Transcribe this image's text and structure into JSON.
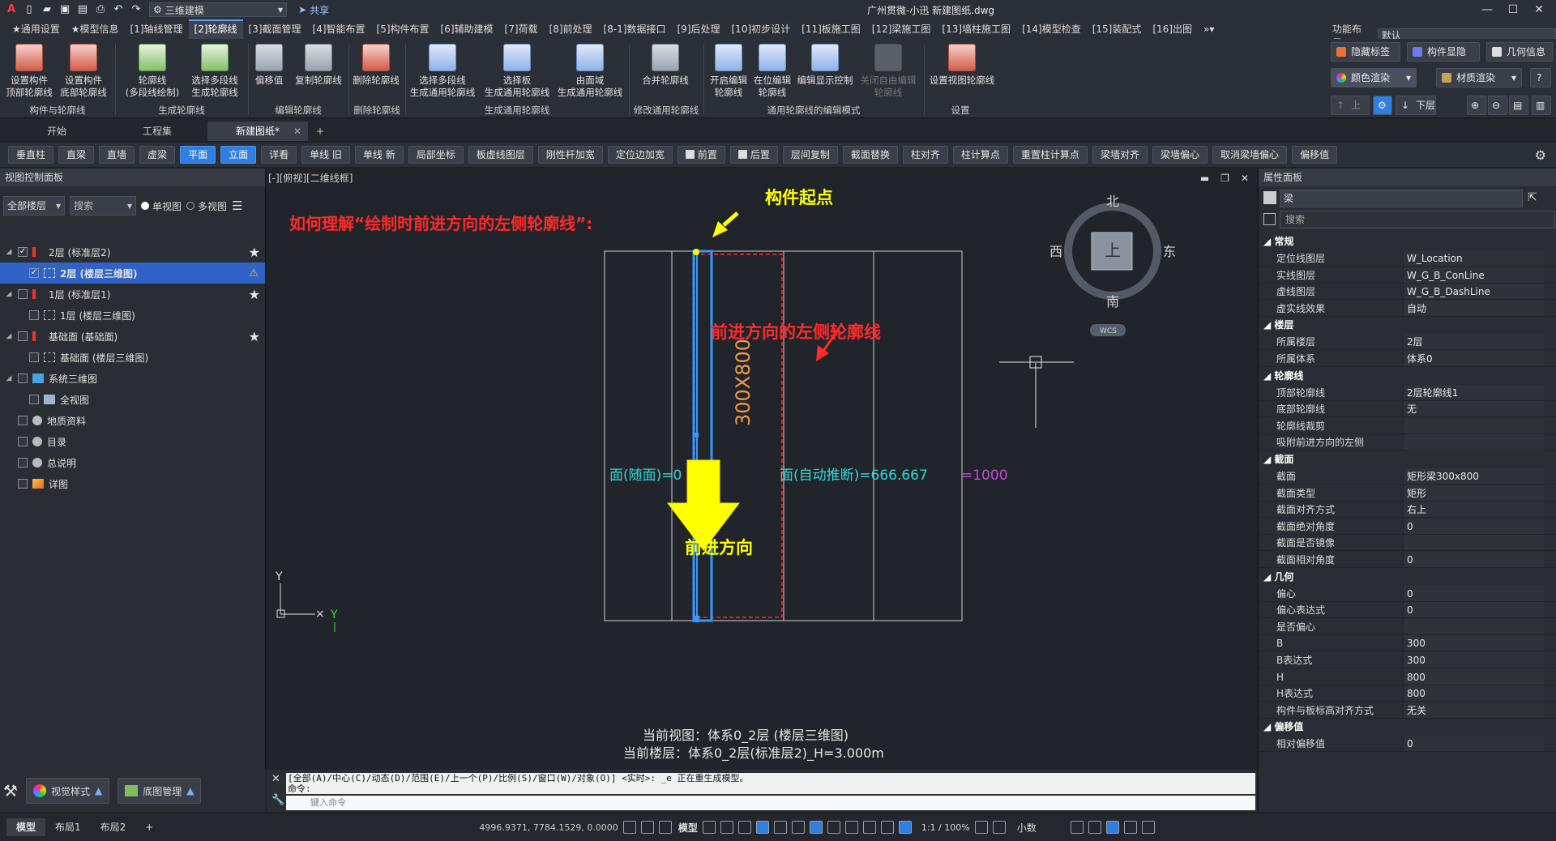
{
  "titlebar": {
    "workspace": "三维建模",
    "share": "共享",
    "doc_title": "广州贯微-小迅    新建图纸.dwg",
    "win_min": "—",
    "win_max": "☐",
    "win_close": "✕"
  },
  "menu": [
    "★通用设置",
    "★模型信息",
    "[1]轴线管理",
    "[2]轮廓线",
    "[3]截面管理",
    "[4]智能布置",
    "[5]构件布置",
    "[6]辅助建模",
    "[7]荷载",
    "[8]前处理",
    "[8-1]数据接口",
    "[9]后处理",
    "[10]初步设计",
    "[11]板施工图",
    "[12]梁施工图",
    "[13]墙柱施工图",
    "[14]模型检查",
    "[15]装配式",
    "[16]出图"
  ],
  "function_layout": {
    "label": "功能布局:",
    "value": "默认"
  },
  "ribbon": {
    "buttons": [
      {
        "label": "设置构件\n顶部轮廓线"
      },
      {
        "label": "设置构件\n底部轮廓线"
      },
      {
        "label": "轮廓线\n(多段线绘制)"
      },
      {
        "label": "选择多段线\n生成轮廓线"
      },
      {
        "label": "偏移值"
      },
      {
        "label": "复制轮廓线"
      },
      {
        "label": "删除轮廓线"
      },
      {
        "label": "选择多段线\n生成通用轮廓线"
      },
      {
        "label": "选择板\n生成通用轮廓线"
      },
      {
        "label": "由面域\n生成通用轮廓线"
      },
      {
        "label": "合并轮廓线"
      },
      {
        "label": "开启编辑\n轮廓线"
      },
      {
        "label": "在位编辑\n轮廓线"
      },
      {
        "label": "编辑显示控制"
      },
      {
        "label": "关闭自由编辑\n轮廓线"
      },
      {
        "label": "设置视图轮廓线"
      }
    ],
    "groups": [
      "构件与轮廓线",
      "生成轮廓线",
      "编辑轮廓线",
      "删除轮廓线",
      "生成通用轮廓线",
      "修改通用轮廓线",
      "通用轮廓线的编辑模式",
      "设置"
    ]
  },
  "right_panel_buttons": [
    "隐藏标签",
    "构件显隐",
    "几何信息",
    "颜色渲染",
    "材质渲染",
    "上层",
    "下层"
  ],
  "doc_tabs": [
    "开始",
    "工程集",
    "新建图纸*"
  ],
  "toolbar2": [
    "垂直柱",
    "直梁",
    "直墙",
    "虚梁",
    "平面",
    "立面",
    "详看",
    "单线 旧",
    "单线 新",
    "局部坐标",
    "板虚线图层",
    "刚性杆加宽",
    "定位边加宽",
    "前置",
    "后置",
    "层间复制",
    "截面替换",
    "柱对齐",
    "柱计算点",
    "重置柱计算点",
    "梁墙对齐",
    "梁墙偏心",
    "取消梁墙偏心",
    "偏移值"
  ],
  "left_panel": {
    "title": "视图控制面板",
    "floor_select": "全部楼层",
    "search_placeholder": "搜索",
    "single_view": "单视图",
    "multi_view": "多视图",
    "tree": [
      {
        "label": "2层  (标准层2)"
      },
      {
        "label": "2层  (楼层三维图)"
      },
      {
        "label": "1层  (标准层1)"
      },
      {
        "label": "1层  (楼层三维图)"
      },
      {
        "label": "基础面  (基础面)"
      },
      {
        "label": "基础面  (楼层三维图)"
      },
      {
        "label": "系统三维图"
      },
      {
        "label": "全视图"
      },
      {
        "label": "地质资料"
      },
      {
        "label": "目录"
      },
      {
        "label": "总说明"
      },
      {
        "label": "详图"
      }
    ],
    "bottom_buttons": [
      "视觉样式",
      "底图管理"
    ]
  },
  "viewport": {
    "header": "[-][俯视][二维线框]",
    "question": "如何理解“绘制时前进方向的左侧轮廓线”:",
    "start_label": "构件起点",
    "left_contour_label": "前进方向的左侧轮廓线",
    "forward_label": "前进方向",
    "section_label": "300X800",
    "overlap_text_1": "面(随面)=0",
    "overlap_text_2": "面(自动推断)=666.667",
    "overlap_text_3": "=1000",
    "compass": {
      "n": "北",
      "s": "南",
      "e": "东",
      "w": "西",
      "top": "上",
      "wcs": "WCS"
    },
    "axis_y": "Y",
    "axis_y_green": "Y",
    "status_line1": "当前视图：体系0_2层 (楼层三维图)",
    "status_line2": "当前楼层：体系0_2层(标准层2)_H=3.000m"
  },
  "properties": {
    "title": "属性面板",
    "type": "梁",
    "search_placeholder": "搜索",
    "sections": [
      {
        "name": "常规",
        "rows": [
          [
            "定位线图层",
            "W_Location"
          ],
          [
            "实线图层",
            "W_G_B_ConLine"
          ],
          [
            "虚线图层",
            "W_G_B_DashLine"
          ],
          [
            "虚实线效果",
            "自动"
          ]
        ]
      },
      {
        "name": "楼层",
        "rows": [
          [
            "所属楼层",
            "2层"
          ],
          [
            "所属体系",
            "体系0"
          ]
        ]
      },
      {
        "name": "轮廓线",
        "rows": [
          [
            "顶部轮廓线",
            "2层轮廓线1"
          ],
          [
            "底部轮廓线",
            "无"
          ],
          [
            "轮廓线裁剪",
            "☑"
          ],
          [
            "吸附前进方向的左侧",
            "☑"
          ]
        ]
      },
      {
        "name": "截面",
        "rows": [
          [
            "截面",
            "矩形梁300x800"
          ],
          [
            "截面类型",
            "矩形"
          ],
          [
            "截面对齐方式",
            "右上"
          ],
          [
            "截面绝对角度",
            "0"
          ],
          [
            "截面是否镜像",
            "☐"
          ],
          [
            "截面相对角度",
            "0"
          ]
        ]
      },
      {
        "name": "几何",
        "rows": [
          [
            "偏心",
            "0"
          ],
          [
            "偏心表达式",
            "0"
          ],
          [
            "是否偏心",
            "☐"
          ],
          [
            "B",
            "300"
          ],
          [
            "B表达式",
            "300"
          ],
          [
            "H",
            "800"
          ],
          [
            "H表达式",
            "800"
          ],
          [
            "构件与板标高对齐方式",
            "无关"
          ]
        ]
      },
      {
        "name": "偏移值",
        "rows": [
          [
            "相对偏移值",
            "0"
          ]
        ]
      }
    ]
  },
  "command": {
    "output_line1": "[全部(A)/中心(C)/动态(D)/范围(E)/上一个(P)/比例(S)/窗口(W)/对象(O)] <实时>: _e 正在重生成模型。",
    "output_line2": "命令:",
    "input_placeholder": "键入命令"
  },
  "statusbar": {
    "tabs": [
      "模型",
      "布局1",
      "布局2"
    ],
    "coords": "4996.9371, 7784.1529, 0.0000",
    "model_label": "模型",
    "scale": "1:1 / 100%",
    "units": "小数"
  },
  "colors": {
    "accent": "#2f7ee0",
    "beam_blue": "#3399ff",
    "annot_red": "#ff2a2a",
    "annot_yellow": "#ffff00"
  }
}
